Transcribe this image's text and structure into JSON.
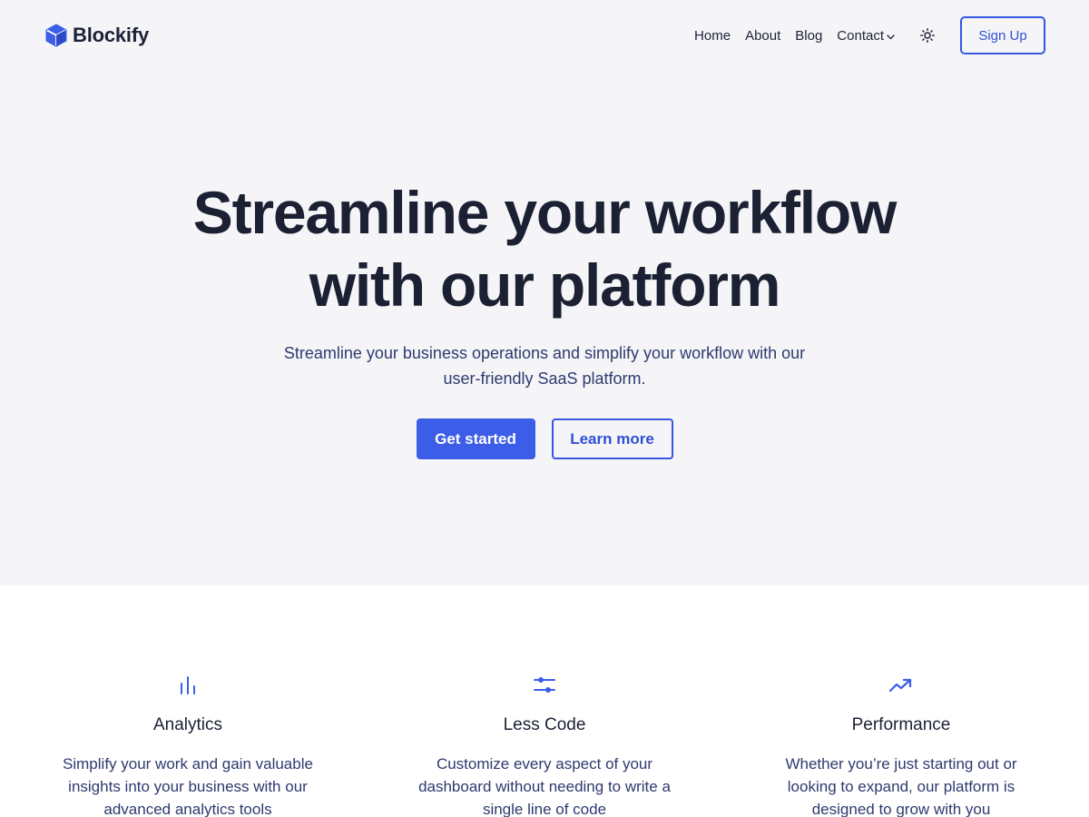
{
  "brand": {
    "name": "Blockify",
    "logo_icon": "cube-icon",
    "accent_color": "#3b5de7"
  },
  "nav": {
    "items": [
      {
        "label": "Home"
      },
      {
        "label": "About"
      },
      {
        "label": "Blog"
      },
      {
        "label": "Contact",
        "has_dropdown": true
      }
    ],
    "theme_toggle_icon": "sun-icon",
    "signup_label": "Sign Up"
  },
  "hero": {
    "title": "Streamline your workflow with our platform",
    "subtitle": "Streamline your business operations and simplify your workflow with our user-friendly SaaS platform.",
    "primary_cta": "Get started",
    "secondary_cta": "Learn more"
  },
  "features": [
    {
      "icon": "bar-chart-icon",
      "title": "Analytics",
      "text": "Simplify your work and gain valuable insights into your business with our advanced analytics tools"
    },
    {
      "icon": "sliders-icon",
      "title": "Less Code",
      "text": "Customize every aspect of your dashboard without needing to write a single line of code"
    },
    {
      "icon": "trending-up-icon",
      "title": "Performance",
      "text": "Whether you’re just starting out or looking to expand, our platform is designed to grow with you"
    }
  ]
}
